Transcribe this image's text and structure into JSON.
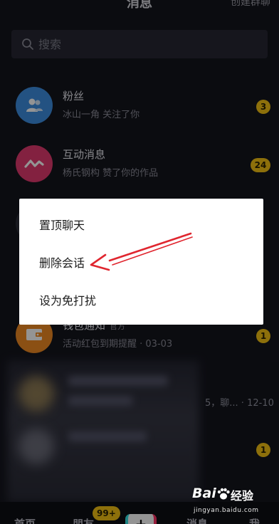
{
  "header": {
    "title": "消息",
    "action": "创建群聊"
  },
  "search": {
    "placeholder": "搜索"
  },
  "conversations": [
    {
      "name": "粉丝",
      "preview": "冰山一角 关注了你",
      "badge": "3"
    },
    {
      "name": "互动消息",
      "preview": "杨氏钢构 赞了你的作品",
      "badge": "24"
    },
    {
      "name": "钱包通知",
      "tag": "官方",
      "preview": "活动红包到期提醒 · 03-03",
      "badge": "1"
    }
  ],
  "hidden_rows": [
    {
      "preview_fragment": "5，聊... · 12-10"
    },
    {
      "badge": "1"
    }
  ],
  "context_menu": {
    "items": [
      "置顶聊天",
      "删除会话",
      "设为免打扰"
    ]
  },
  "bottom_nav": {
    "home": "首页",
    "friends": "朋友",
    "friends_badge": "99+",
    "add": "+",
    "messages": "消息",
    "me": "我"
  },
  "watermark": {
    "brand": "Bai",
    "suffix": "经验",
    "url": "jingyan.baidu.com"
  },
  "colors": {
    "badge": "#f3c214",
    "background": "#14151d",
    "search_bg": "#262733",
    "menu_bg": "#ffffff",
    "arrow": "#e0262f",
    "fans_avatar": "#3d8ee0",
    "interaction_avatar": "#e23a6e",
    "wallet_avatar": "#f08a24"
  }
}
